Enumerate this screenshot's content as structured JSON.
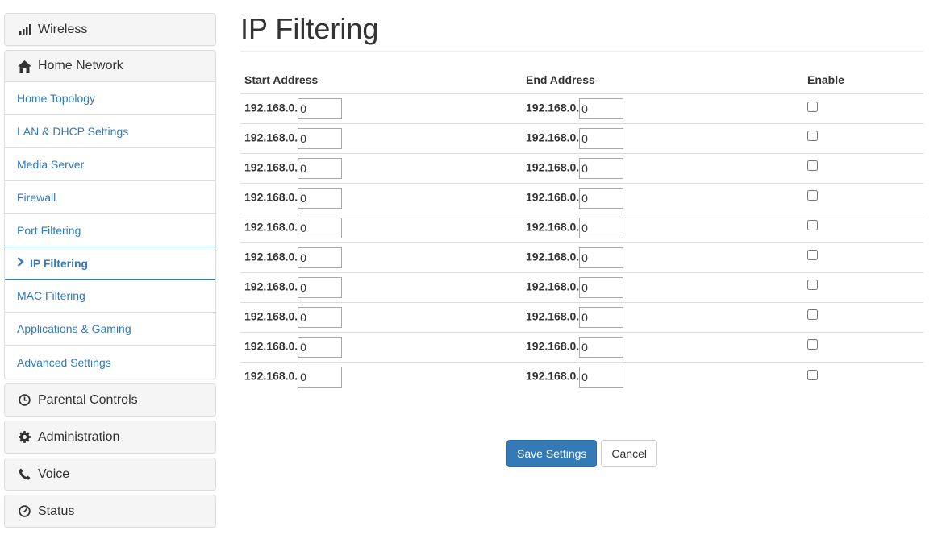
{
  "sidebar": {
    "wireless": {
      "label": "Wireless",
      "icon": "signal-bars-icon"
    },
    "home_network": {
      "label": "Home Network",
      "icon": "home-icon",
      "items": [
        {
          "label": "Home Topology"
        },
        {
          "label": "LAN & DHCP Settings"
        },
        {
          "label": "Media Server"
        },
        {
          "label": "Firewall"
        },
        {
          "label": "Port Filtering"
        },
        {
          "label": "IP Filtering",
          "active": true
        },
        {
          "label": "MAC Filtering"
        },
        {
          "label": "Applications & Gaming"
        },
        {
          "label": "Advanced Settings"
        }
      ]
    },
    "parental_controls": {
      "label": "Parental Controls",
      "icon": "clock-icon"
    },
    "administration": {
      "label": "Administration",
      "icon": "gear-icon"
    },
    "voice": {
      "label": "Voice",
      "icon": "phone-icon"
    },
    "status": {
      "label": "Status",
      "icon": "dashboard-icon"
    }
  },
  "main": {
    "title": "IP Filtering",
    "table": {
      "headers": {
        "start": "Start Address",
        "end": "End Address",
        "enable": "Enable"
      },
      "rows": [
        {
          "start_prefix": "192.168.0.",
          "start_octet": "0",
          "end_prefix": "192.168.0.",
          "end_octet": "0",
          "enabled": false
        },
        {
          "start_prefix": "192.168.0.",
          "start_octet": "0",
          "end_prefix": "192.168.0.",
          "end_octet": "0",
          "enabled": false
        },
        {
          "start_prefix": "192.168.0.",
          "start_octet": "0",
          "end_prefix": "192.168.0.",
          "end_octet": "0",
          "enabled": false
        },
        {
          "start_prefix": "192.168.0.",
          "start_octet": "0",
          "end_prefix": "192.168.0.",
          "end_octet": "0",
          "enabled": false
        },
        {
          "start_prefix": "192.168.0.",
          "start_octet": "0",
          "end_prefix": "192.168.0.",
          "end_octet": "0",
          "enabled": false
        },
        {
          "start_prefix": "192.168.0.",
          "start_octet": "0",
          "end_prefix": "192.168.0.",
          "end_octet": "0",
          "enabled": false
        },
        {
          "start_prefix": "192.168.0.",
          "start_octet": "0",
          "end_prefix": "192.168.0.",
          "end_octet": "0",
          "enabled": false
        },
        {
          "start_prefix": "192.168.0.",
          "start_octet": "0",
          "end_prefix": "192.168.0.",
          "end_octet": "0",
          "enabled": false
        },
        {
          "start_prefix": "192.168.0.",
          "start_octet": "0",
          "end_prefix": "192.168.0.",
          "end_octet": "0",
          "enabled": false
        },
        {
          "start_prefix": "192.168.0.",
          "start_octet": "0",
          "end_prefix": "192.168.0.",
          "end_octet": "0",
          "enabled": false
        }
      ]
    },
    "buttons": {
      "save": "Save Settings",
      "cancel": "Cancel"
    }
  },
  "colors": {
    "link": "#337ab7",
    "primary": "#337ab7",
    "border": "#dddddd"
  }
}
